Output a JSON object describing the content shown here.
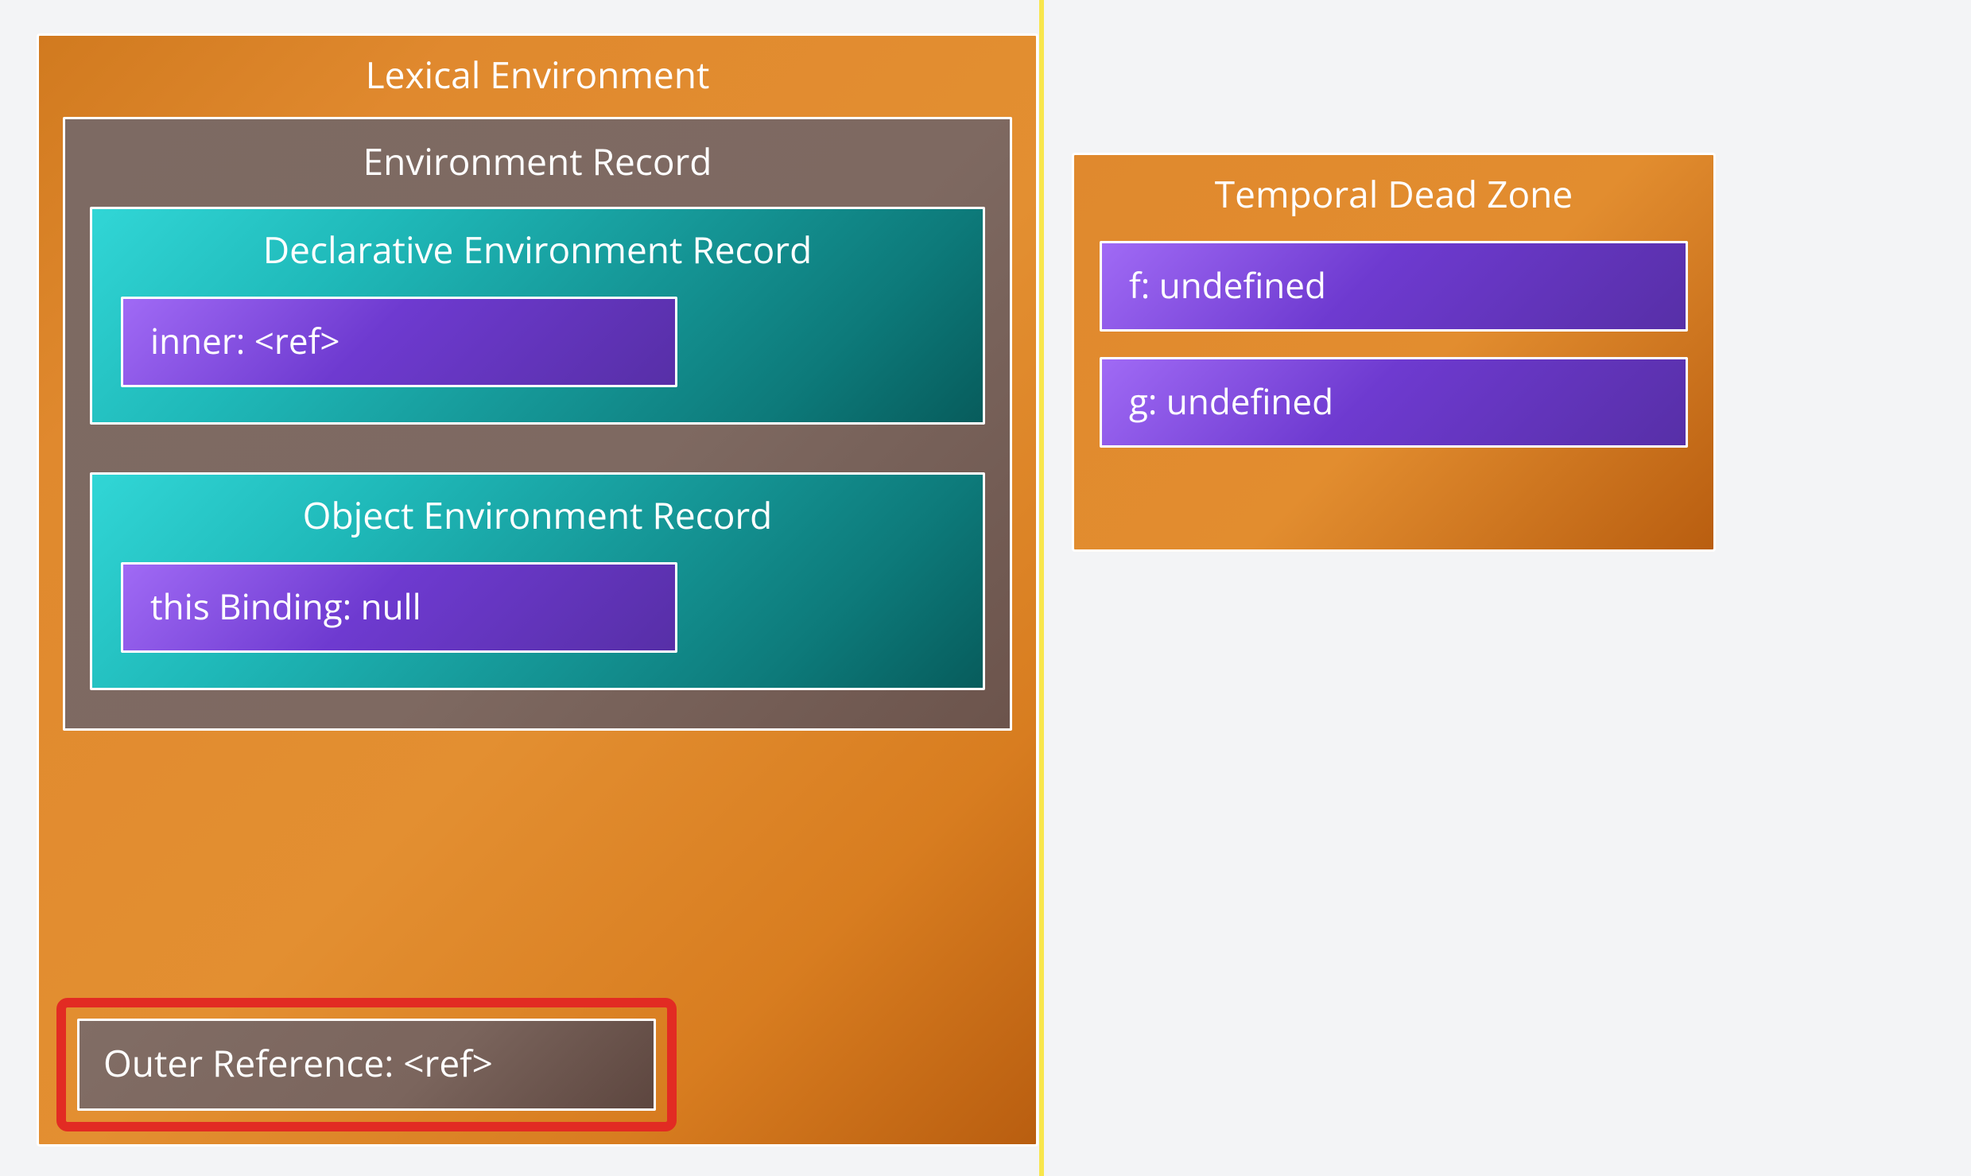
{
  "lexicalEnv": {
    "title": "Lexical Environment",
    "envRecord": {
      "title": "Environment Record",
      "declarative": {
        "title": "Declarative Environment Record",
        "binding": "inner: <ref>"
      },
      "object": {
        "title": "Object Environment Record",
        "binding": "this Binding: null"
      }
    },
    "outerReference": "Outer Reference: <ref>"
  },
  "tdz": {
    "title": "Temporal Dead Zone",
    "bindings": [
      "f: undefined",
      "g: undefined"
    ]
  },
  "colors": {
    "orange": "#e0892e",
    "brown": "#7d6a63",
    "teal": "#1fb9b9",
    "purple": "#6e3ad0",
    "redHighlight": "#e22b23",
    "yellowBar": "#f8e43a"
  }
}
